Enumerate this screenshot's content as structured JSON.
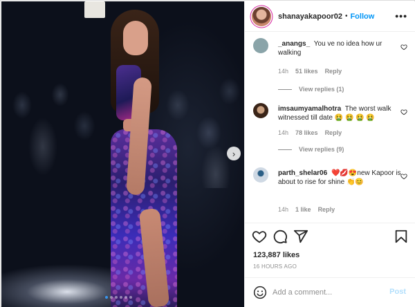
{
  "post": {
    "username": "shanayakapoor02",
    "separator": "•",
    "follow_label": "Follow",
    "more_label": "•••"
  },
  "carousel": {
    "next_label": "›",
    "slide_count": 6,
    "active_index": 0
  },
  "comments": [
    {
      "username": "_anangs_",
      "text": "You ve no idea how ur walking",
      "time": "14h",
      "likes": "51 likes",
      "reply": "Reply",
      "view_replies": "View replies (1)",
      "avatar_color": "#8aa4a9"
    },
    {
      "username": "imsaumyamalhotra",
      "text": "The worst walk witnessed till date 🤮 🤮 🤮 🤮",
      "time": "14h",
      "likes": "78 likes",
      "reply": "Reply",
      "view_replies": "View replies (9)",
      "avatar_color": "#5a3a2a"
    },
    {
      "username": "parth_shelar06",
      "text": "❤️💋😍new Kapoor is about to rise for shine 👏😊",
      "time": "14h",
      "likes": "1 like",
      "reply": "Reply",
      "view_replies": "",
      "avatar_color": "#a8b7c9"
    }
  ],
  "actions": {
    "like_icon": "heart-icon",
    "comment_icon": "comment-icon",
    "share_icon": "share-icon",
    "save_icon": "bookmark-icon"
  },
  "stats": {
    "likes": "123,887 likes",
    "time": "16 HOURS AGO"
  },
  "add_comment": {
    "placeholder": "Add a comment...",
    "post_label": "Post"
  },
  "colors": {
    "accent": "#0095f6",
    "post_disabled": "#b2dffc",
    "muted": "#8e8e8e"
  }
}
